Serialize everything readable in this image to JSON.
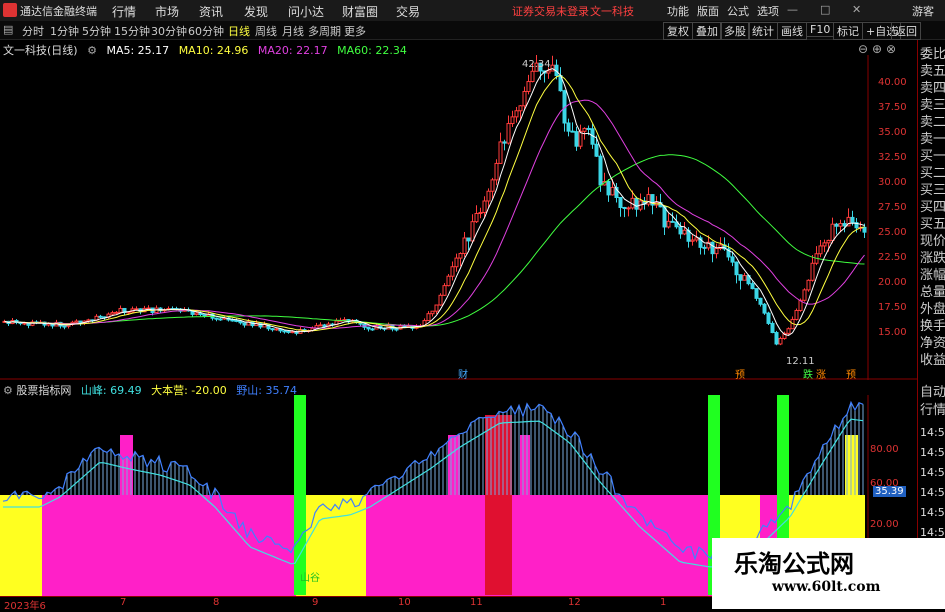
{
  "menubar": {
    "app_name": "通达信金融终端",
    "items": [
      "行情",
      "市场",
      "资讯",
      "发现",
      "问小达",
      "财富圈",
      "交易"
    ],
    "notice": "证券交易未登录",
    "stock": "文一科技",
    "right_items": [
      "功能",
      "版面",
      "公式",
      "选项"
    ],
    "guest": "游客"
  },
  "toolbar": {
    "periods": [
      "分时",
      "1分钟",
      "5分钟",
      "15分钟",
      "30分钟",
      "60分钟",
      "日线",
      "周线",
      "月线",
      "多周期",
      "更多"
    ],
    "active_index": 6,
    "right_buttons": [
      "复权",
      "叠加",
      "多股",
      "统计",
      "画线",
      "F10",
      "标记",
      "+自选",
      "返回"
    ]
  },
  "main_chart": {
    "title": "文一科技(日线)",
    "ma5": "MA5: 25.17",
    "ma10": "MA10: 24.96",
    "ma20": "MA20: 22.17",
    "ma60": "MA60: 22.34",
    "high_label": "42.34",
    "low_label": "12.11",
    "y_ticks": [
      "40.00",
      "37.50",
      "35.00",
      "32.50",
      "30.00",
      "27.50",
      "25.00",
      "22.50",
      "20.00",
      "17.50",
      "15.00"
    ],
    "markers": [
      {
        "text": "财",
        "color": "#4af"
      },
      {
        "text": "预",
        "color": "#f80"
      },
      {
        "text": "跌",
        "color": "#4f4"
      },
      {
        "text": "涨",
        "color": "#f80"
      },
      {
        "text": "预",
        "color": "#f80"
      }
    ]
  },
  "indicator": {
    "name": "股票指标网",
    "shanfeng": "山峰: 69.49",
    "dabenying": "大本营: -20.00",
    "yeshan": "野山: 35.74",
    "y_ticks": [
      "80.00",
      "60.00",
      "20.00"
    ],
    "current": "35.39",
    "valley_label": "山谷"
  },
  "right_panel": {
    "items": [
      "委比",
      "卖五",
      "卖四",
      "卖三",
      "卖二",
      "卖一",
      "买一",
      "买二",
      "买三",
      "买四",
      "买五",
      "现价",
      "涨跌",
      "涨幅",
      "总量",
      "外盘",
      "换手",
      "净资",
      "收益"
    ],
    "lower_items": [
      "自动",
      "行情"
    ],
    "times": [
      "14:50",
      "14:50",
      "14:50",
      "14:50",
      "14:50",
      "14:50",
      "14:50",
      "14:50"
    ]
  },
  "dates": [
    "2023年6",
    "7",
    "8",
    "9",
    "10",
    "11",
    "12",
    "1"
  ],
  "watermark": {
    "title": "乐淘公式网",
    "url": "www.60lt.com"
  },
  "colors": {
    "up": "#ff3b3b",
    "down": "#3bd6e6",
    "ma5": "#ffffff",
    "ma10": "#ffff40",
    "ma20": "#e040e0",
    "ma60": "#40ff40",
    "magenta": "#ff20c8",
    "yellow": "#ffff20",
    "green": "#20ff20"
  }
}
